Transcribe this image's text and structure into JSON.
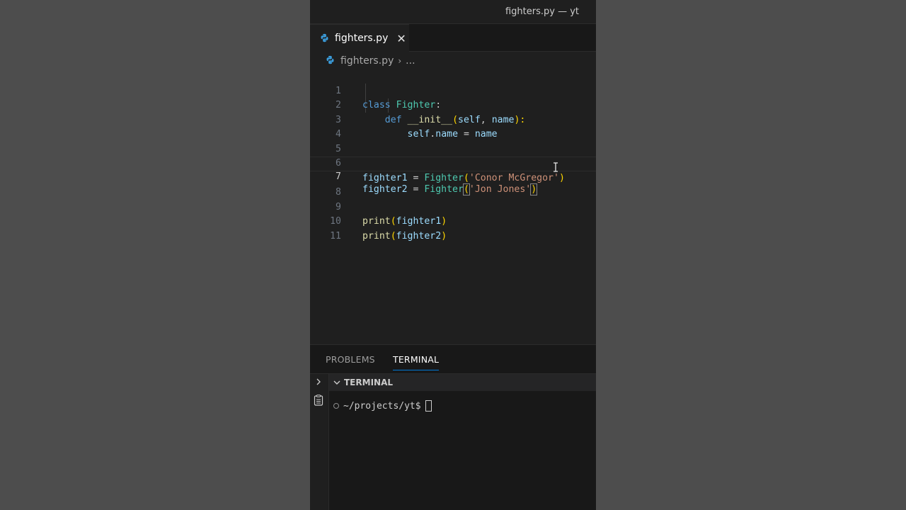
{
  "window": {
    "title": "fighters.py — yt"
  },
  "tab": {
    "label": "fighters.py",
    "close": "✕"
  },
  "breadcrumb": {
    "file": "fighters.py",
    "more": "..."
  },
  "editor": {
    "active_line": 7,
    "lines": [
      {
        "n": "1"
      },
      {
        "n": "2"
      },
      {
        "n": "3"
      },
      {
        "n": "4"
      },
      {
        "n": "5"
      },
      {
        "n": "6"
      },
      {
        "n": "7"
      },
      {
        "n": "8"
      },
      {
        "n": "9"
      },
      {
        "n": "10"
      },
      {
        "n": "11"
      }
    ],
    "tokens": {
      "l1": [
        "class",
        "Fighter",
        ":"
      ],
      "l2": [
        "def",
        "__init__",
        "(",
        "self",
        ", ",
        "name",
        "):"
      ],
      "l3": [
        "self",
        ".",
        "name",
        " = ",
        "name"
      ],
      "l6": [
        "fighter1",
        " = ",
        "Fighter",
        "(",
        "'Conor McGregor'",
        ")"
      ],
      "l7": [
        "fighter2",
        " = ",
        "Fighter",
        "(",
        "'Jon Jones'",
        ")"
      ],
      "l9": [
        "print",
        "(",
        "fighter1",
        ")"
      ],
      "l10": [
        "print",
        "(",
        "fighter2",
        ")"
      ]
    }
  },
  "panel": {
    "tabs": [
      "PROBLEMS",
      "TERMINAL"
    ],
    "active_tab": "TERMINAL",
    "terminal_header": "TERMINAL",
    "prompt": "~/projects/yt$"
  },
  "colors": {
    "keyword": "#569cd6",
    "class": "#4ec9b0",
    "function": "#dcdcaa",
    "variable": "#9cdcfe",
    "string": "#ce9178",
    "accent": "#0078d4"
  },
  "icons": {
    "tab": "python-icon",
    "breadcrumb": "python-icon",
    "panel_toggle": "chevron-right-icon",
    "terminal_list": "list-icon",
    "terminal_header": "chevron-down-icon"
  }
}
